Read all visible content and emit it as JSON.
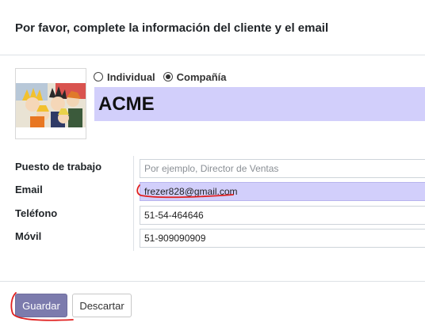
{
  "dialog": {
    "title": "Por favor, complete la información del cliente y el email"
  },
  "contact_type": {
    "options": [
      "Individual",
      "Compañía"
    ],
    "selected": "Compañía"
  },
  "company_name": "ACME",
  "fields": [
    {
      "label": "Puesto de trabajo",
      "value": "",
      "placeholder": "Por ejemplo, Director de Ventas"
    },
    {
      "label": "Email",
      "value": "frezer828@gmail.com",
      "placeholder": ""
    },
    {
      "label": "Teléfono",
      "value": "51-54-464646",
      "placeholder": ""
    },
    {
      "label": "Móvil",
      "value": "51-909090909",
      "placeholder": ""
    }
  ],
  "buttons": {
    "save": "Guardar",
    "discard": "Descartar"
  },
  "colors": {
    "highlight_field": "#d2cffb",
    "primary_button": "#7c7bad",
    "annotation": "#e0201f"
  },
  "icons": {
    "avatar": "anime-characters-avatar-image"
  }
}
